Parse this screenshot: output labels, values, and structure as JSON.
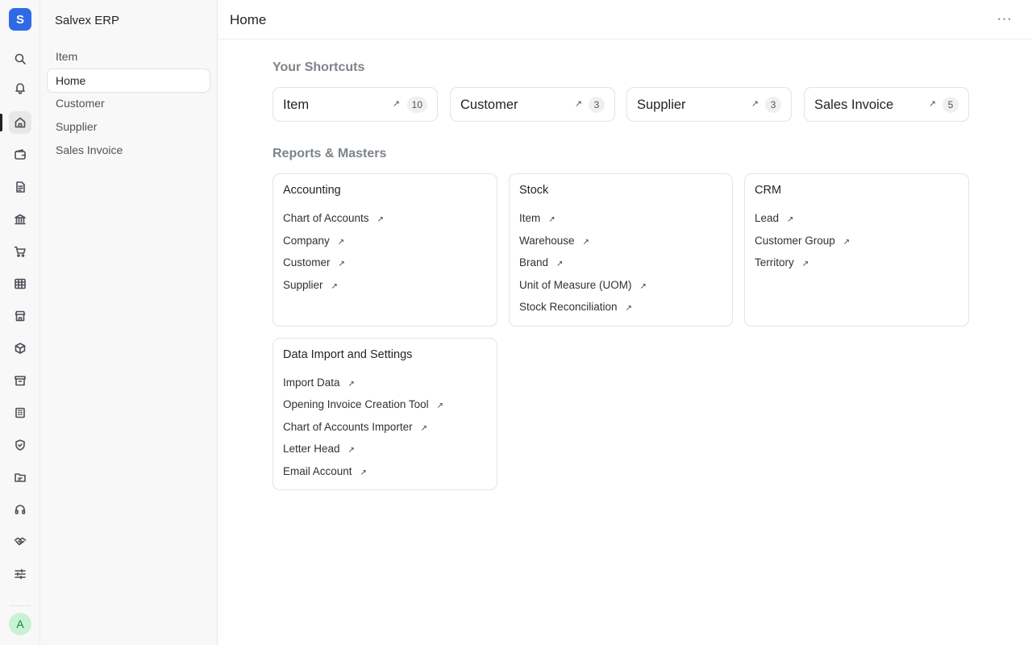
{
  "app": {
    "logo_letter": "S",
    "name": "Salvex ERP",
    "avatar_letter": "A"
  },
  "rail_icons": [
    "search-icon",
    "bell-icon",
    "home-icon",
    "wallet-icon",
    "file-text-icon",
    "bank-icon",
    "cart-icon",
    "table-icon",
    "store-icon",
    "package-icon",
    "archive-icon",
    "building-icon",
    "shield-check-icon",
    "folder-icon",
    "headset-icon",
    "handshake-icon",
    "sliders-icon"
  ],
  "sidebar": {
    "items": [
      {
        "label": "Item"
      },
      {
        "label": "Home",
        "active": true
      },
      {
        "label": "Customer"
      },
      {
        "label": "Supplier"
      },
      {
        "label": "Sales Invoice"
      }
    ]
  },
  "header": {
    "title": "Home",
    "more_label": "···"
  },
  "shortcuts": {
    "title": "Your Shortcuts",
    "items": [
      {
        "label": "Item",
        "count": "10"
      },
      {
        "label": "Customer",
        "count": "3"
      },
      {
        "label": "Supplier",
        "count": "3"
      },
      {
        "label": "Sales Invoice",
        "count": "5"
      }
    ]
  },
  "reports": {
    "title": "Reports & Masters",
    "cards": [
      {
        "title": "Accounting",
        "links": [
          "Chart of Accounts",
          "Company",
          "Customer",
          "Supplier"
        ]
      },
      {
        "title": "Stock",
        "links": [
          "Item",
          "Warehouse",
          "Brand",
          "Unit of Measure (UOM)",
          "Stock Reconciliation"
        ]
      },
      {
        "title": "CRM",
        "links": [
          "Lead",
          "Customer Group",
          "Territory"
        ]
      },
      {
        "title": "Data Import and Settings",
        "links": [
          "Import Data",
          "Opening Invoice Creation Tool",
          "Chart of Accounts Importer",
          "Letter Head",
          "Email Account"
        ]
      }
    ]
  },
  "arrow_glyph": "↗"
}
